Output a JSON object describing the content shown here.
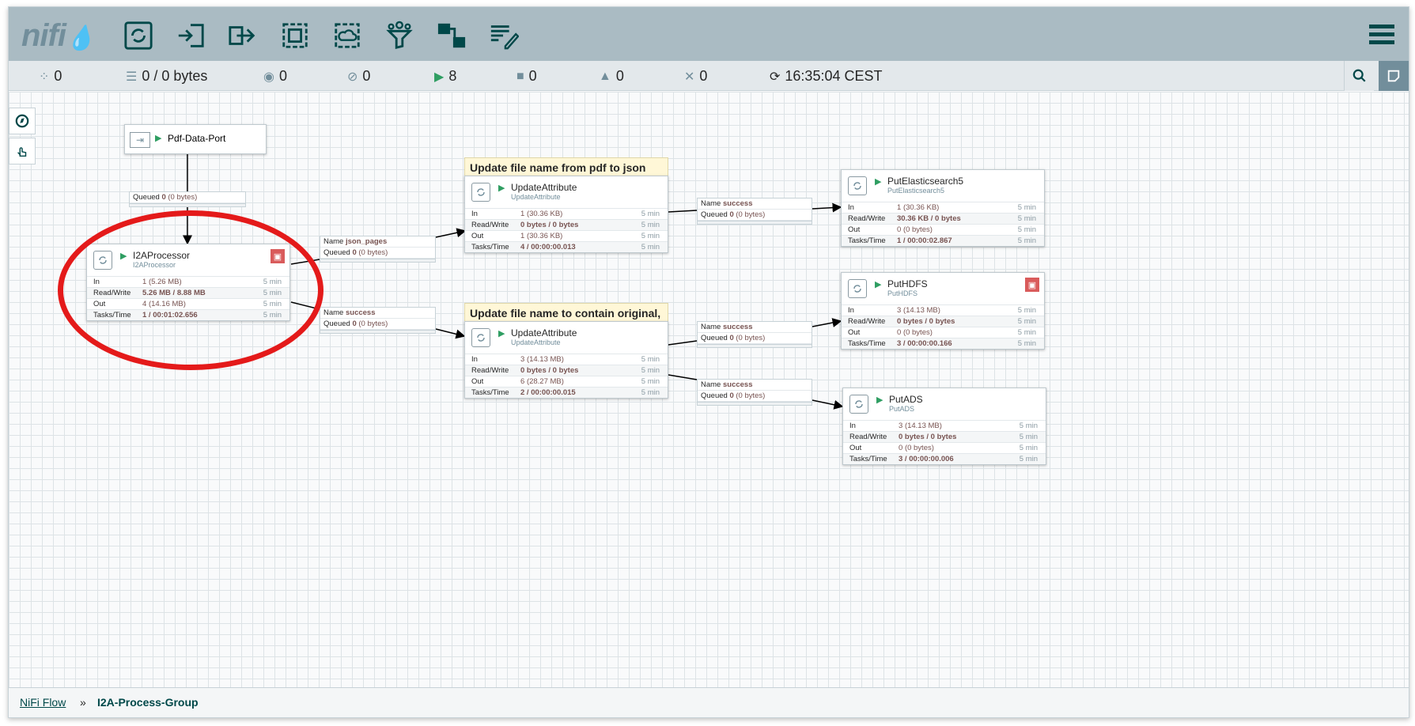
{
  "header": {
    "logo": "nifi",
    "toolbar": [
      "processor-icon",
      "input-port-icon",
      "output-port-icon",
      "process-group-icon",
      "remote-process-group-icon",
      "funnel-icon",
      "template-icon",
      "label-icon"
    ]
  },
  "status_bar": {
    "active_threads": "0",
    "queued": "0 / 0 bytes",
    "transmitting": "0",
    "not_transmitting": "0",
    "running": "8",
    "stopped": "0",
    "invalid": "0",
    "disabled": "0",
    "refresh_time": "16:35:04 CEST"
  },
  "input_port": {
    "name": "Pdf-Data-Port"
  },
  "labels": {
    "label1": "Update file name from pdf to json",
    "label2": "Update file name to contain original, text"
  },
  "processors": {
    "i2a": {
      "name": "I2AProcessor",
      "type": "I2AProcessor",
      "in": "1",
      "in_size": "(5.26 MB)",
      "rw": "5.26 MB / 8.88 MB",
      "out": "4",
      "out_size": "(14.16 MB)",
      "tasks": "1 / 00:01:02.656",
      "time": "5 min"
    },
    "ua1": {
      "name": "UpdateAttribute",
      "type": "UpdateAttribute",
      "in": "1",
      "in_size": "(30.36 KB)",
      "rw": "0 bytes / 0 bytes",
      "out": "1",
      "out_size": "(30.36 KB)",
      "tasks": "4 / 00:00:00.013",
      "time": "5 min"
    },
    "ua2": {
      "name": "UpdateAttribute",
      "type": "UpdateAttribute",
      "in": "3",
      "in_size": "(14.13 MB)",
      "rw": "0 bytes / 0 bytes",
      "out": "6",
      "out_size": "(28.27 MB)",
      "tasks": "2 / 00:00:00.015",
      "time": "5 min"
    },
    "es": {
      "name": "PutElasticsearch5",
      "type": "PutElasticsearch5",
      "in": "1",
      "in_size": "(30.36 KB)",
      "rw": "30.36 KB / 0 bytes",
      "out": "0",
      "out_size": "(0 bytes)",
      "tasks": "1 / 00:00:02.867",
      "time": "5 min"
    },
    "hdfs": {
      "name": "PutHDFS",
      "type": "PutHDFS",
      "in": "3",
      "in_size": "(14.13 MB)",
      "rw": "0 bytes / 0 bytes",
      "out": "0",
      "out_size": "(0 bytes)",
      "tasks": "3 / 00:00:00.166",
      "time": "5 min"
    },
    "ads": {
      "name": "PutADS",
      "type": "PutADS",
      "in": "3",
      "in_size": "(14.13 MB)",
      "rw": "0 bytes / 0 bytes",
      "out": "0",
      "out_size": "(0 bytes)",
      "tasks": "3 / 00:00:00.006",
      "time": "5 min"
    }
  },
  "row_labels": {
    "in": "In",
    "rw": "Read/Write",
    "out": "Out",
    "tasks": "Tasks/Time"
  },
  "connections": {
    "name_label": "Name",
    "queued_label": "Queued",
    "queued_value": "0",
    "queued_size": "(0 bytes)",
    "c_port": {
      "name": ""
    },
    "c_json": {
      "name": "json_pages"
    },
    "c_success1": {
      "name": "success"
    },
    "c_es": {
      "name": "success"
    },
    "c_hdfs": {
      "name": "success"
    },
    "c_ads": {
      "name": "success"
    }
  },
  "breadcrumb": {
    "root": "NiFi Flow",
    "separator": "»",
    "current": "I2A-Process-Group"
  },
  "colors": {
    "header": "#aabbc3",
    "accent": "#728e9b",
    "running": "#2f9e62",
    "highlight": "#e41a1a"
  }
}
